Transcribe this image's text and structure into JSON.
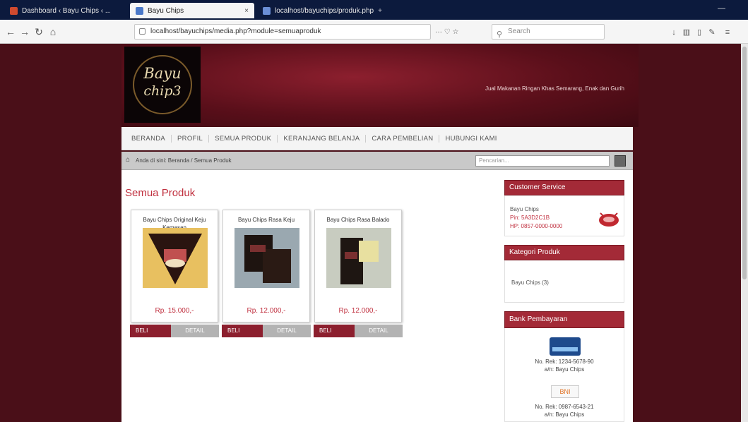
{
  "browser": {
    "tabs": [
      {
        "title": "Dashboard ‹ Bayu Chips ‹ ...",
        "icon": "wordpress-icon"
      },
      {
        "title": "Bayu Chips",
        "icon": "page-icon"
      },
      {
        "title": "localhost/bayuchips/produk.php",
        "icon": "page-icon"
      }
    ],
    "url": "localhost/bayuchips/media.php?module=semuaproduk",
    "search_placeholder": "Search",
    "url_tools": "···  ♡  ☆"
  },
  "site": {
    "logo_line1": "Bayu",
    "logo_line2": "chip3",
    "tagline": "Jual Makanan Ringan Khas Semarang, Enak dan Gurih",
    "menu": [
      "BERANDA",
      "PROFIL",
      "SEMUA PRODUK",
      "KERANJANG BELANJA",
      "CARA PEMBELIAN",
      "HUBUNGI KAMI"
    ],
    "breadcrumb": "Anda di sini: Beranda / Semua Produk",
    "search_placeholder": "Pencarian..."
  },
  "main": {
    "title": "Semua Produk",
    "products": [
      {
        "name": "Bayu Chips Original Keju Kemasan",
        "price": "Rp. 15.000,-",
        "buy": "BELI",
        "detail": "DETAIL"
      },
      {
        "name": "Bayu Chips Rasa Keju",
        "price": "Rp. 12.000,-",
        "buy": "BELI",
        "detail": "DETAIL"
      },
      {
        "name": "Bayu Chips Rasa Balado",
        "price": "Rp. 12.000,-",
        "buy": "BELI",
        "detail": "DETAIL"
      }
    ]
  },
  "sidebar": {
    "customer": {
      "title": "Customer Service",
      "lines": [
        "Bayu Chips",
        "Pin: 5A3D2C1B",
        "HP: 0857-0000-0000"
      ]
    },
    "categories": {
      "title": "Kategori Produk",
      "items": [
        "Bayu Chips (3)"
      ]
    },
    "bank": {
      "title": "Bank Pembayaran",
      "accounts": [
        {
          "line1": "No. Rek: 1234-5678-90",
          "line2": "a/n: Bayu Chips",
          "logo": "BCA"
        },
        {
          "line1": "No. Rek: 0987-6543-21",
          "line2": "a/n: Bayu Chips",
          "logo": "BNI"
        }
      ]
    }
  },
  "colors": {
    "page_bg": "#4a0f18",
    "header_accent": "#8c1f2e",
    "title_red": "#c0303f",
    "widget_red": "#a32a37"
  }
}
